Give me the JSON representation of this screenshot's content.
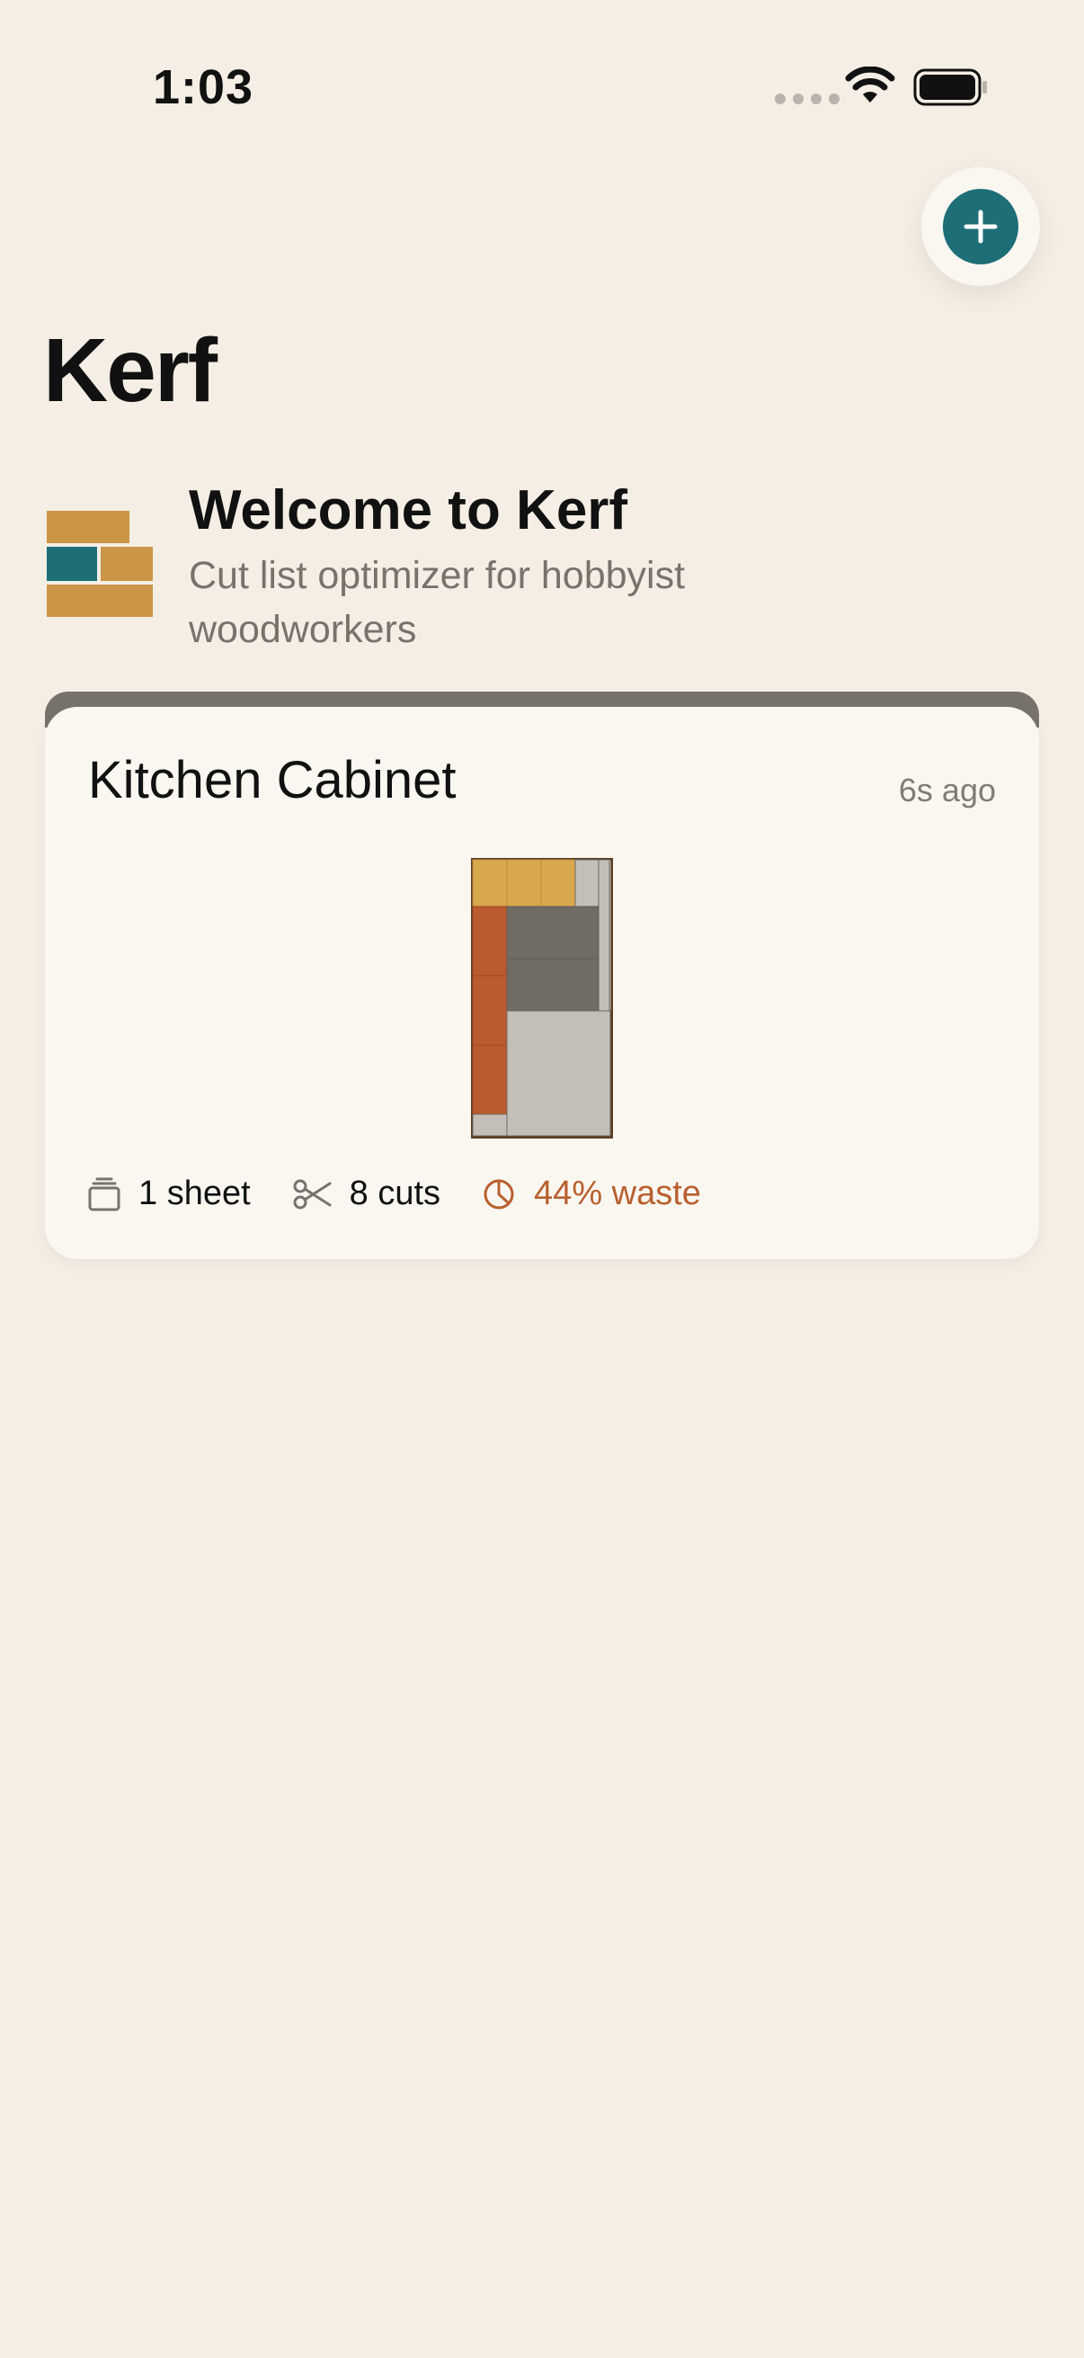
{
  "status_bar": {
    "time": "1:03"
  },
  "header": {
    "title": "Kerf",
    "add_button_icon": "plus-icon"
  },
  "welcome": {
    "title": "Welcome to Kerf",
    "subtitle": "Cut list optimizer for hobbyist woodworkers",
    "logo_icon": "wood-planks-icon"
  },
  "projects": [
    {
      "name": "Kitchen Cabinet",
      "updated": "6s ago",
      "sheets": "1 sheet",
      "cuts": "8 cuts",
      "waste": "44% waste"
    }
  ],
  "colors": {
    "accent": "#1d6e77",
    "background": "#f5eee4",
    "card": "#faf7f1",
    "waste": "#b8602e",
    "plank": "#cb9547",
    "piece_yellow": "#d8a84c",
    "piece_orange": "#bc5a2f",
    "piece_gray": "#706b65",
    "offcut": "#c3bfb8"
  }
}
